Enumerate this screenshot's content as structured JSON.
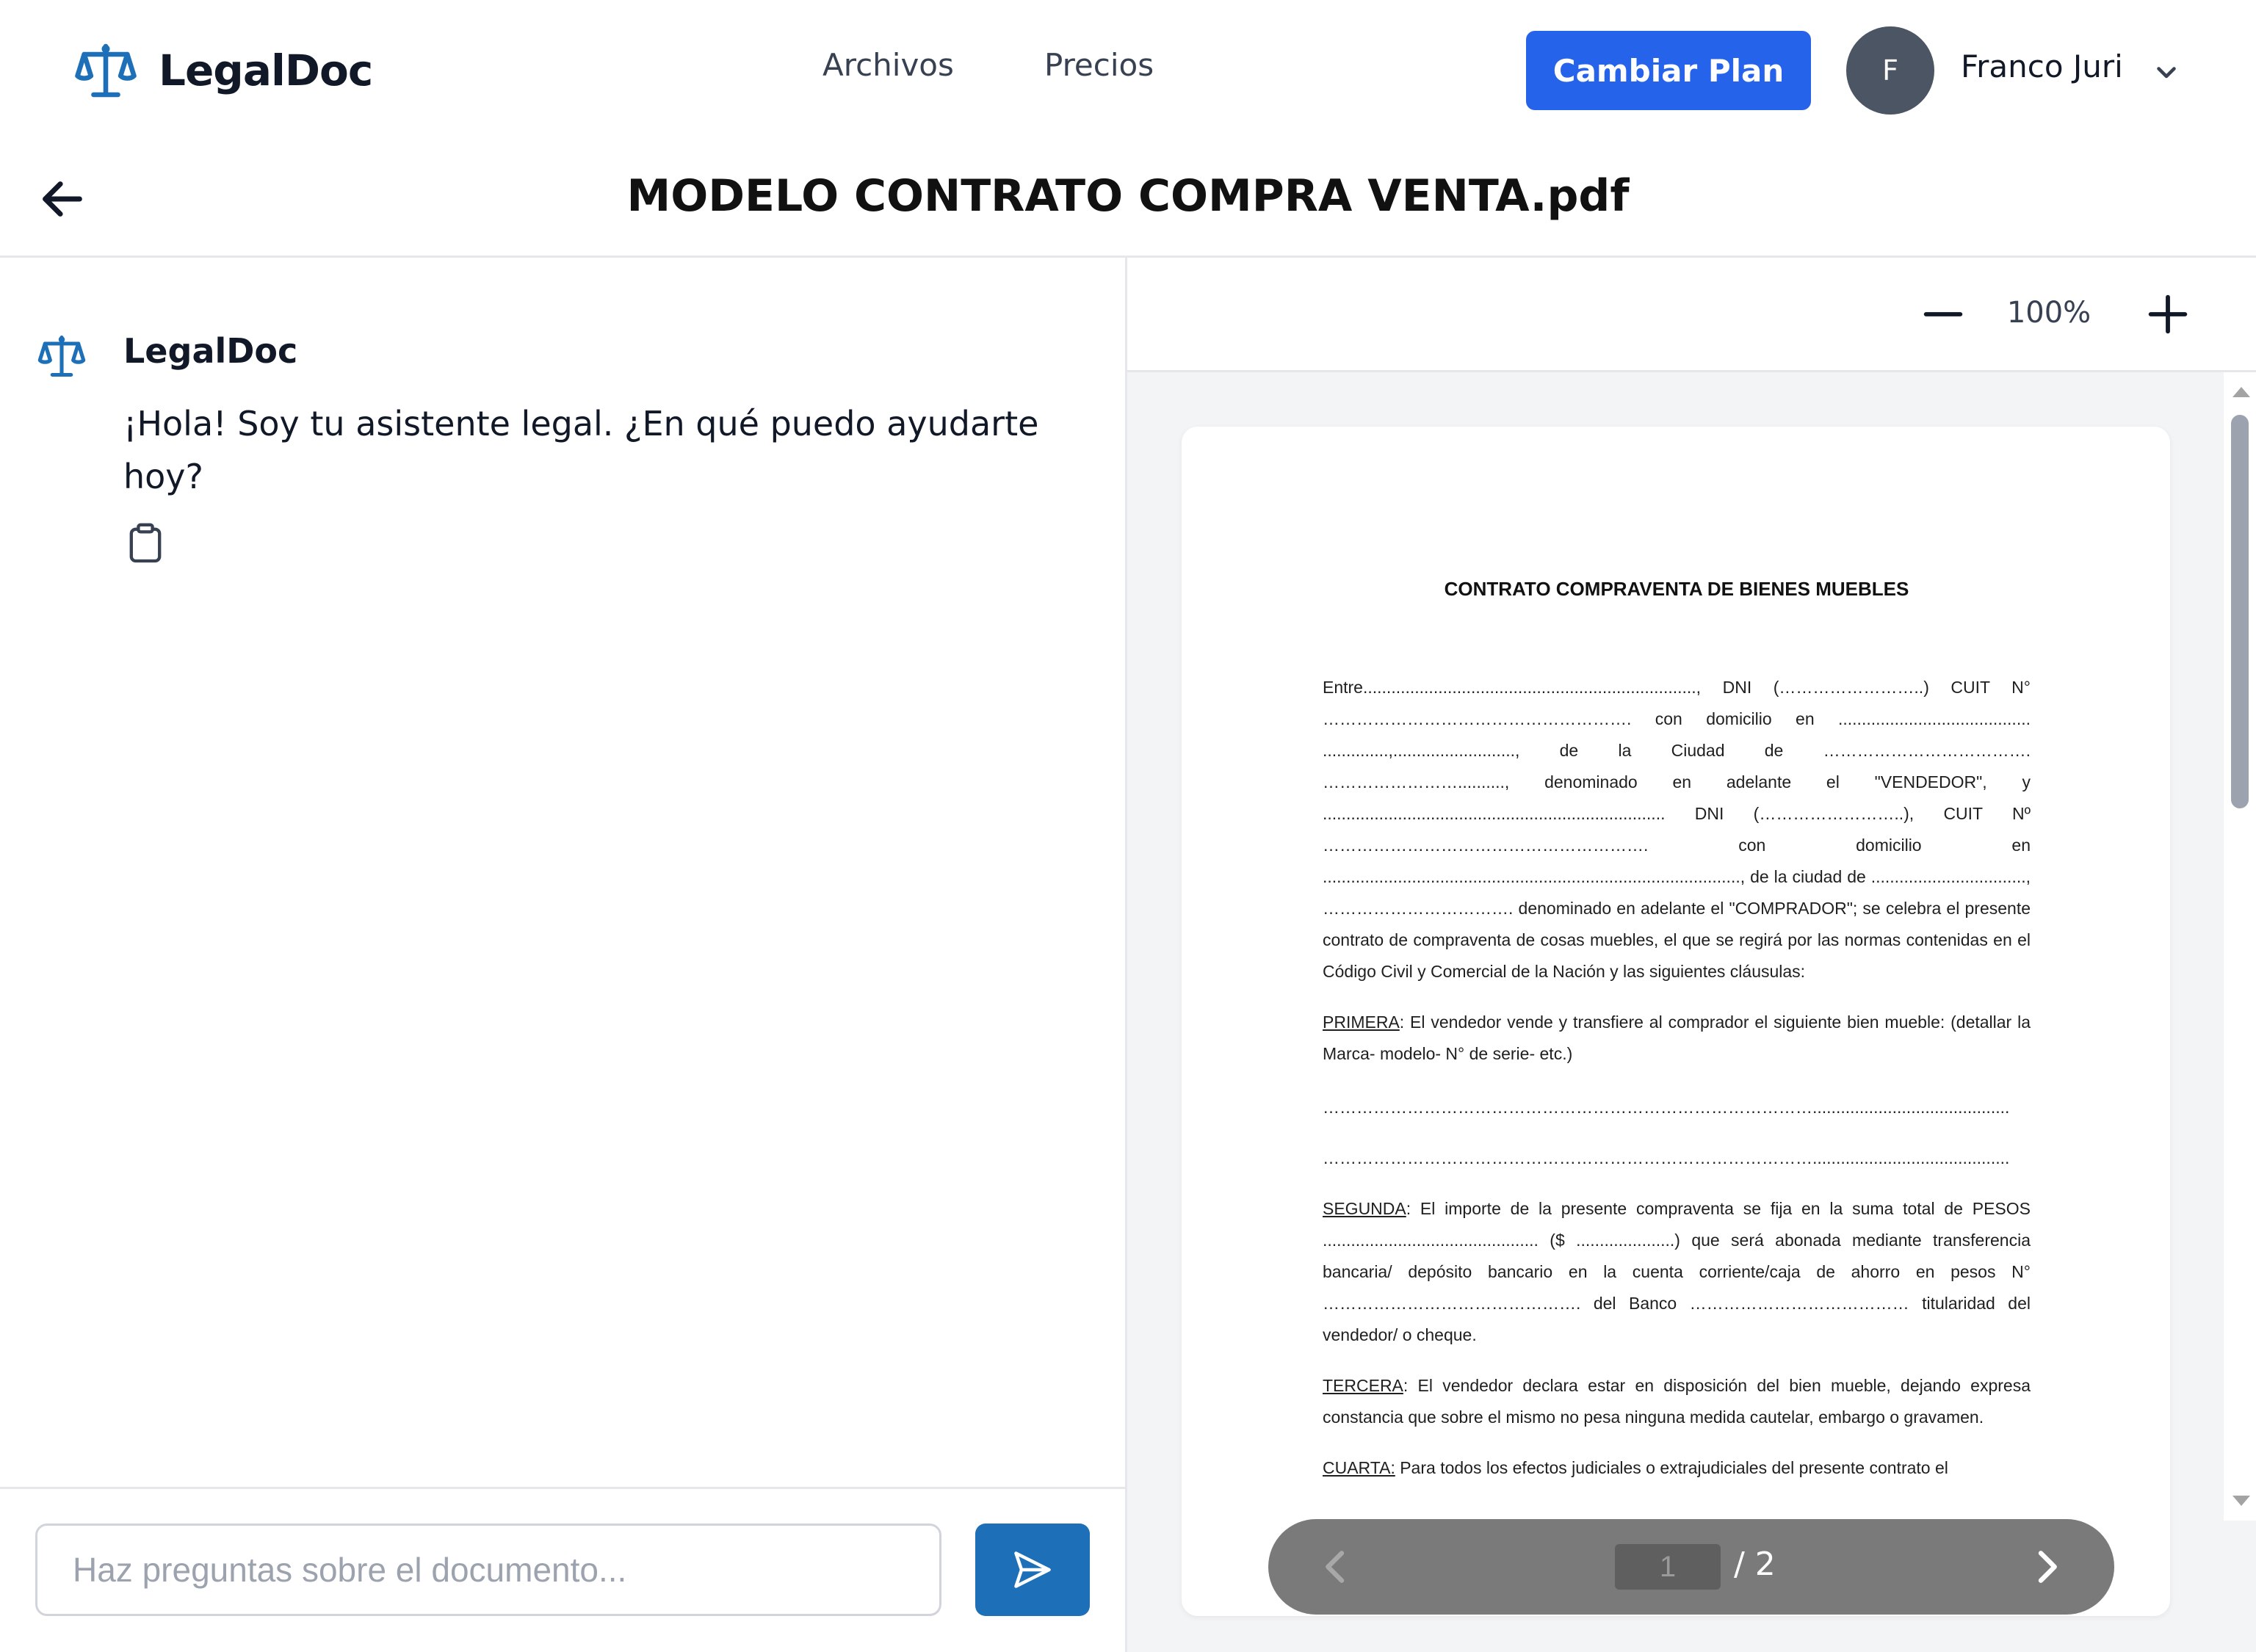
{
  "navbar": {
    "brand": "LegalDoc",
    "links": [
      "Archivos",
      "Precios"
    ],
    "cta": "Cambiar Plan",
    "user": {
      "initial": "F",
      "name": "Franco Juri"
    }
  },
  "document": {
    "title": "MODELO CONTRATO COMPRA VENTA.pdf"
  },
  "chat": {
    "message": {
      "sender": "LegalDoc",
      "text": "¡Hola! Soy tu asistente legal. ¿En qué puedo ayudarte hoy?"
    },
    "input_placeholder": "Haz preguntas sobre el documento..."
  },
  "viewer": {
    "zoom": "100%",
    "page_current": "1",
    "page_total": "/ 2",
    "content": {
      "heading": "CONTRATO COMPRAVENTA DE BIENES MUEBLES",
      "intro": "Entre......................................................................., DNI (……………………..) CUIT N° ………………………………………………. con domicilio en ......................................... ..............,.........................., de la Ciudad de ………………………………. …………………….........., denominado en adelante el \"VENDEDOR\", y ......................................................................... DNI (……………………..), CUIT Nº …………………………………………………. con domicilio en ........................................................................................., de la ciudad de ................................., ……………………………. denominado en adelante el \"COMPRADOR\"; se celebra el presente contrato de compraventa de cosas muebles, el que se regirá por las normas contenidas en el Código Civil y Comercial de la Nación y las siguientes cláusulas:",
      "primera_label": "PRIMERA",
      "primera_text": ": El vendedor vende y transfiere al comprador el siguiente bien mueble: (detallar la Marca- modelo- N° de serie- etc.)",
      "dots_1": "……………………………………………………………………………..........................................",
      "dots_2": "……………………………………………………………………………..........................................",
      "segunda_label": "SEGUNDA",
      "segunda_text": ": El importe de la presente compraventa se fija en la suma total de PESOS .............................................. ($ .....................) que será abonada mediante transferencia bancaria/ depósito bancario en la cuenta corriente/caja de ahorro en pesos N° ………………………………………. del Banco ………………………………… titularidad del vendedor/ o cheque.",
      "tercera_label": "TERCERA",
      "tercera_text": ": El vendedor declara estar en disposición del bien mueble, dejando expresa constancia que sobre el mismo no pesa ninguna medida cautelar, embargo o gravamen.",
      "cuarta_label": "CUARTA:",
      "cuarta_text": " Para todos los efectos judiciales o extrajudiciales del presente contrato el"
    }
  },
  "colors": {
    "primary": "#2563eb",
    "send": "#1d6fb8",
    "logo": "#1d6fb8",
    "avatar": "#4b5563",
    "pager": "#7a7a7a"
  },
  "icons": [
    "scales-icon",
    "arrow-left-icon",
    "chevron-down-icon",
    "clipboard-icon",
    "send-icon",
    "minus-icon",
    "plus-icon",
    "chevron-left-icon",
    "chevron-right-icon"
  ]
}
